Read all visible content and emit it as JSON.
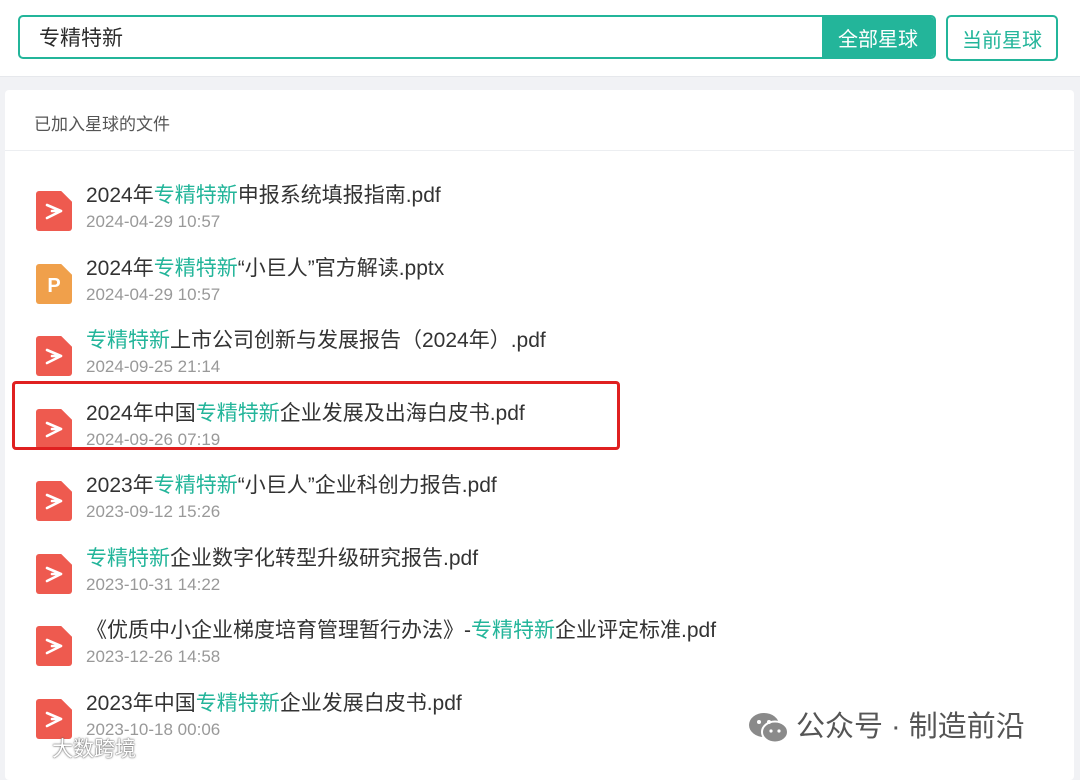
{
  "search": {
    "value": "专精特新",
    "all_button": "全部星球",
    "current_button": "当前星球"
  },
  "panel": {
    "title": "已加入星球的文件"
  },
  "files": [
    {
      "type": "pdf",
      "pre": "2024年",
      "hl": "专精特新",
      "post": "申报系统填报指南.pdf",
      "date": "2024-04-29 10:57"
    },
    {
      "type": "pptx",
      "pre": "2024年",
      "hl": "专精特新",
      "post": "“小巨人”官方解读.pptx",
      "date": "2024-04-29 10:57"
    },
    {
      "type": "pdf",
      "pre": "",
      "hl": "专精特新",
      "post": "上市公司创新与发展报告（2024年）.pdf",
      "date": "2024-09-25 21:14"
    },
    {
      "type": "pdf",
      "pre": "2024年中国",
      "hl": "专精特新",
      "post": "企业发展及出海白皮书.pdf",
      "date": "2024-09-26 07:19"
    },
    {
      "type": "pdf",
      "pre": "2023年",
      "hl": "专精特新",
      "post": "“小巨人”企业科创力报告.pdf",
      "date": "2023-09-12 15:26"
    },
    {
      "type": "pdf",
      "pre": "",
      "hl": "专精特新",
      "post": "企业数字化转型升级研究报告.pdf",
      "date": "2023-10-31 14:22"
    },
    {
      "type": "pdf",
      "pre": "《优质中小企业梯度培育管理暂行办法》-",
      "hl": "专精特新",
      "post": "企业评定标准.pdf",
      "date": "2023-12-26 14:58"
    },
    {
      "type": "pdf",
      "pre": "2023年中国",
      "hl": "专精特新",
      "post": "企业发展白皮书.pdf",
      "date": "2023-10-18 00:06"
    }
  ],
  "watermarks": {
    "right": "公众号 · 制造前沿",
    "left": "大数跨境"
  },
  "colors": {
    "accent": "#23b59a",
    "pdf_icon": "#ee5a4f",
    "pptx_icon": "#f0a04b",
    "highlight_border": "#e02020"
  }
}
